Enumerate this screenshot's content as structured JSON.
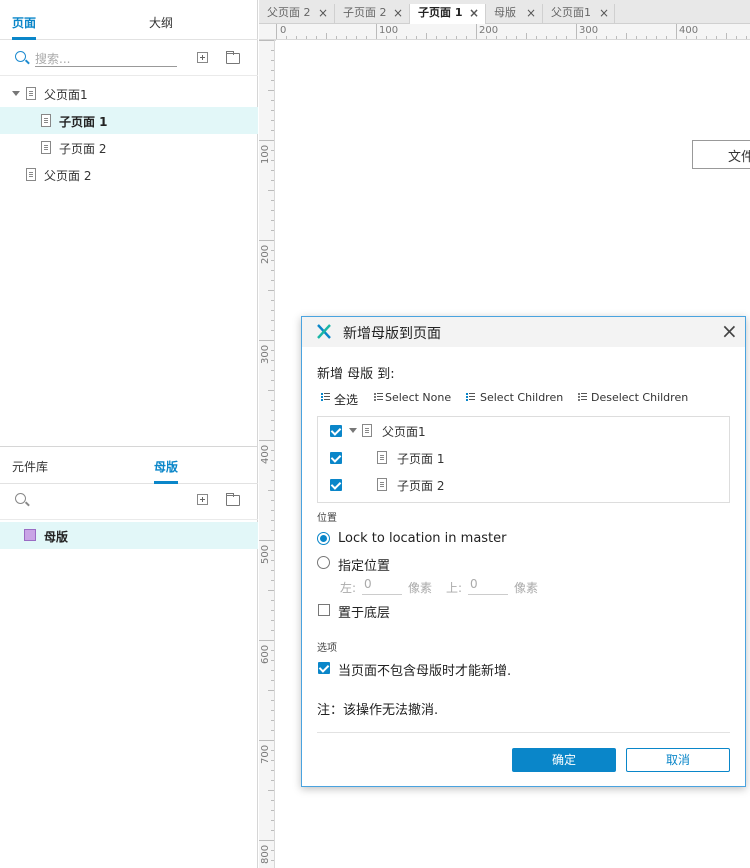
{
  "pages_panel": {
    "tabs": [
      "页面",
      "大纲"
    ],
    "search_placeholder": "搜索...",
    "tree": [
      {
        "label": "父页面1",
        "expanded": true
      },
      {
        "label": "子页面 1",
        "selected": true
      },
      {
        "label": "子页面 2"
      },
      {
        "label": "父页面 2"
      }
    ]
  },
  "masters_panel": {
    "tabs": [
      "元件库",
      "母版"
    ],
    "items": [
      {
        "label": "母版"
      }
    ]
  },
  "doc_tabs": [
    {
      "label": "父页面 2"
    },
    {
      "label": "子页面 2"
    },
    {
      "label": "子页面 1",
      "active": true
    },
    {
      "label": "母版"
    },
    {
      "label": "父页面1"
    }
  ],
  "ruler": {
    "h_labels": [
      "0",
      "100",
      "200",
      "300",
      "400"
    ],
    "v_labels": [
      "100",
      "200",
      "300",
      "400",
      "500",
      "600",
      "700",
      "800"
    ]
  },
  "canvas": {
    "widget_text": "文件"
  },
  "dialog": {
    "title": "新增母版到页面",
    "subtitle": "新增 母版 到:",
    "toolbar": {
      "select_all": "全选",
      "select_none": "Select None",
      "select_children": "Select Children",
      "deselect_children": "Deselect Children"
    },
    "tree": [
      {
        "label": "父页面1",
        "checked": true
      },
      {
        "label": "子页面 1",
        "checked": true
      },
      {
        "label": "子页面 2",
        "checked": true
      }
    ],
    "position_section": "位置",
    "radio_lock": "Lock to location in master",
    "radio_specify": "指定位置",
    "left_label": "左:",
    "left_value": "0",
    "top_label": "上:",
    "top_value": "0",
    "unit_px": "像素",
    "send_back": "置于底层",
    "options_section": "选项",
    "only_if_missing": "当页面不包含母版时才能新增.",
    "note": "注：该操作无法撤消.",
    "ok": "确定",
    "cancel": "取消"
  },
  "colors": {
    "accent": "#0a86c9",
    "selected_row": "#e2f7f8"
  }
}
